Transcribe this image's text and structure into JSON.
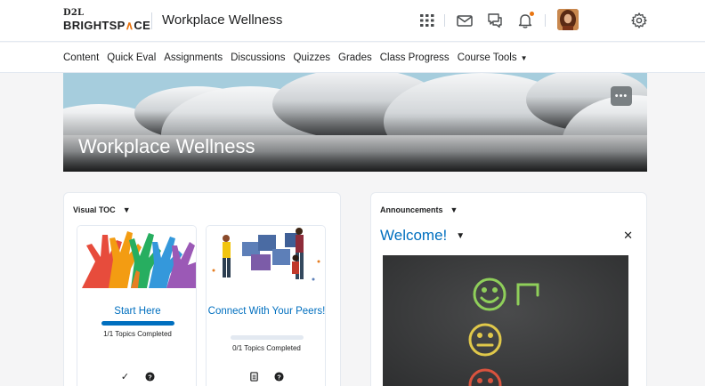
{
  "header": {
    "logo_top": "D2L",
    "logo_bottom_a": "BRIGHTSP",
    "logo_bottom_b": "∧",
    "logo_bottom_c": "CE",
    "course_title": "Workplace Wellness",
    "icons": [
      "grid-icon",
      "mail-icon",
      "chat-icon",
      "bell-icon",
      "avatar",
      "gear-icon"
    ],
    "notification_color": "#e87511"
  },
  "nav": {
    "items": [
      {
        "label": "Content"
      },
      {
        "label": "Quick Eval"
      },
      {
        "label": "Assignments"
      },
      {
        "label": "Discussions"
      },
      {
        "label": "Quizzes"
      },
      {
        "label": "Grades"
      },
      {
        "label": "Class Progress"
      },
      {
        "label": "Course Tools",
        "has_dropdown": true
      }
    ]
  },
  "banner": {
    "title": "Workplace Wellness",
    "menu_label": "•••"
  },
  "visual_toc": {
    "title": "Visual TOC",
    "cards": [
      {
        "title": "Start Here",
        "progress_text": "1/1  Topics Completed",
        "progress": 1.0,
        "icons": [
          "checkmark-icon",
          "help-icon"
        ]
      },
      {
        "title": "Connect With Your Peers!",
        "progress_text": "0/1  Topics Completed",
        "progress": 0.0,
        "icons": [
          "document-icon",
          "help-icon"
        ]
      }
    ]
  },
  "announcements": {
    "title": "Announcements",
    "heading": "Welcome!",
    "close_label": "✕"
  },
  "colors": {
    "link": "#006fbf",
    "accent": "#e87511"
  }
}
